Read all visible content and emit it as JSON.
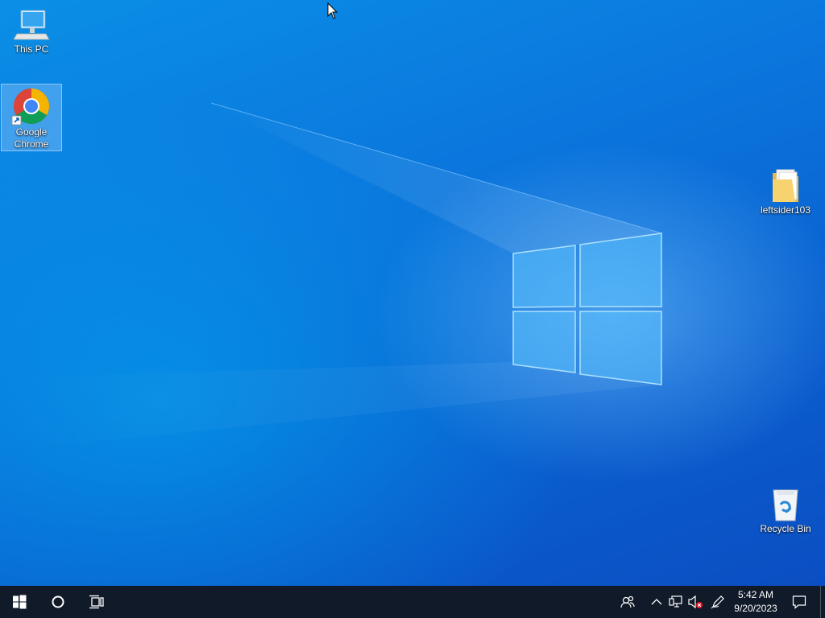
{
  "desktop": {
    "icons": [
      {
        "label": "This PC",
        "icon": "this-pc-icon"
      },
      {
        "label": "Google Chrome",
        "label_line1": "Google",
        "label_line2": "Chrome",
        "icon": "chrome-icon",
        "selected": true
      },
      {
        "label": "leftsider103",
        "icon": "folder-icon"
      },
      {
        "label": "Recycle Bin",
        "icon": "recycle-bin-icon"
      }
    ]
  },
  "taskbar": {
    "start": {
      "icon": "windows-start-icon"
    },
    "search": {
      "icon": "cortana-search-icon"
    },
    "task_view": {
      "icon": "task-view-icon"
    },
    "tray": {
      "people": {
        "icon": "people-icon"
      },
      "show_hidden": {
        "icon": "chevron-up-icon"
      },
      "network": {
        "icon": "network-icon"
      },
      "volume": {
        "icon": "volume-muted-icon"
      },
      "pen": {
        "icon": "pen-workspace-icon"
      },
      "clock": {
        "time": "5:42 AM",
        "date": "9/20/2023"
      },
      "notifications": {
        "icon": "action-center-icon"
      }
    }
  },
  "colors": {
    "taskbar": "#101a28",
    "desktop_accent": "#0a78dc"
  }
}
